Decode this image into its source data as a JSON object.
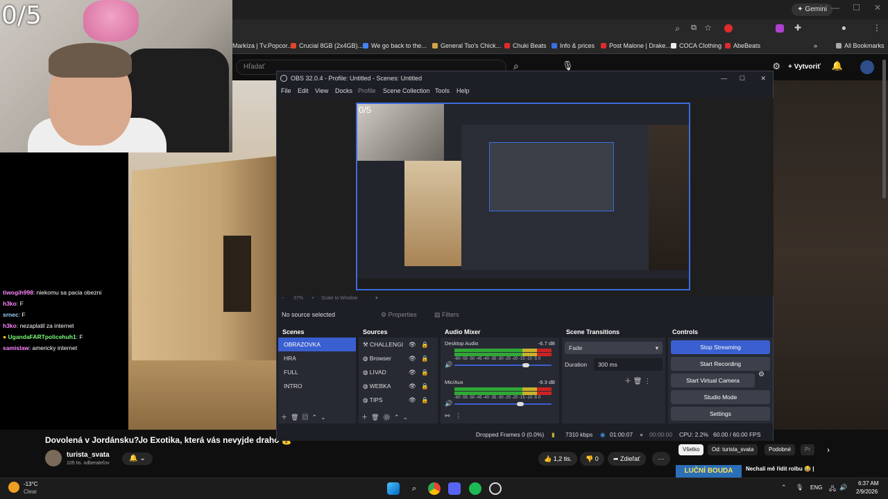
{
  "overlay": {
    "counter": "0/5"
  },
  "chat": [
    {
      "name": "tiwogih998",
      "msg": ": niekomu sa pacia obezni",
      "color": "#ff88ff"
    },
    {
      "name": "h3ko",
      "msg": ": F",
      "color": "#ff88ff"
    },
    {
      "name": "srnec",
      "msg": ": F",
      "color": "#9fd5ff"
    },
    {
      "name": "h3ko",
      "msg": ": nezaplatil za internet",
      "color": "#ff88ff"
    },
    {
      "name": "UgandaFARTpolicehuh1",
      "msg": ": F",
      "color": "#7cfc7c"
    },
    {
      "name": "samislaw",
      "msg": ": americky internet",
      "color": "#ff88ff"
    }
  ],
  "browser": {
    "gemini_label": "Gemini",
    "bookmarks": [
      {
        "label": "Markíza | Tv.Popcor...",
        "color": "#888"
      },
      {
        "label": "Crucial 8GB (2x4GB)...",
        "color": "#e0452b"
      },
      {
        "label": "We go back to the...",
        "color": "#4285f4"
      },
      {
        "label": "General Tso's Chick...",
        "color": "#d4a24a"
      },
      {
        "label": "Chuki Beats",
        "color": "#e02b2b"
      },
      {
        "label": "Info & prices",
        "color": "#3a6de0"
      },
      {
        "label": "Post Malone | Drake...",
        "color": "#e02b2b"
      },
      {
        "label": "COCA Clothing",
        "color": "#eee"
      },
      {
        "label": "AbeBeats",
        "color": "#e02b2b"
      }
    ],
    "all_bookmarks": "All Bookmarks"
  },
  "youtube": {
    "search_placeholder": "Hľadať",
    "create_label": "Vytvoriť",
    "video_title": "Dovolená v Jordánsku?Ꭻo Exotika, která vás nevyjde draho 💰",
    "channel": "turista_svata",
    "subscribers": "105 tis. odberateľov",
    "likes": "1,2 tis.",
    "dislikes": "0",
    "share": "Zdieľať",
    "chips": [
      "Všetko",
      "Od: turista_svata",
      "Podobné",
      "Pr"
    ],
    "rec_thumb_text": "LUČNÍ BOUDA",
    "rec_title": "Nechali mě řídit rolbu 😂 |"
  },
  "obs": {
    "title": "OBS 32.0.4 - Profile: Untitled - Scenes: Untitled",
    "menu": [
      "File",
      "Edit",
      "View",
      "Docks",
      "Profile",
      "Scene Collection",
      "Tools",
      "Help"
    ],
    "preview_counter": "0/5",
    "zoom": "37%",
    "scale_label": "Scale to Window",
    "no_source": "No source selected",
    "properties": "Properties",
    "filters": "Filters",
    "scenes_title": "Scenes",
    "scenes": [
      "OBRAZOVKA",
      "HRA",
      "FULL",
      "INTRO"
    ],
    "sources_title": "Sources",
    "sources": [
      "CHALLENGI",
      "Browser",
      "LIVAD",
      "WEBKA",
      "TIPS"
    ],
    "mixer_title": "Audio Mixer",
    "channels": [
      {
        "name": "Desktop Audio",
        "db": "-6.7 dB"
      },
      {
        "name": "Mic/Aux",
        "db": "-9.3 dB"
      }
    ],
    "meter_scale": "-60 -55 -50 -45 -40 -35 -30 -25 -20 -15 -10 -5 0",
    "transitions_title": "Scene Transitions",
    "transition": "Fade",
    "duration_label": "Duration",
    "duration_value": "300 ms",
    "controls_title": "Controls",
    "controls": [
      "Stop Streaming",
      "Start Recording",
      "Start Virtual Camera",
      "Studio Mode",
      "Settings"
    ],
    "status": {
      "dropped": "Dropped Frames 0 (0.0%)",
      "kbps": "7310 kbps",
      "live_time": "01:00:07",
      "rec_time": "00:00:00",
      "cpu": "CPU: 2.2%",
      "fps": "60.00 / 60.00 FPS"
    }
  },
  "taskbar": {
    "weather_temp": "-13°C",
    "weather_desc": "Clear",
    "lang": "ENG",
    "time": "6:37 AM",
    "date": "2/9/2026"
  }
}
